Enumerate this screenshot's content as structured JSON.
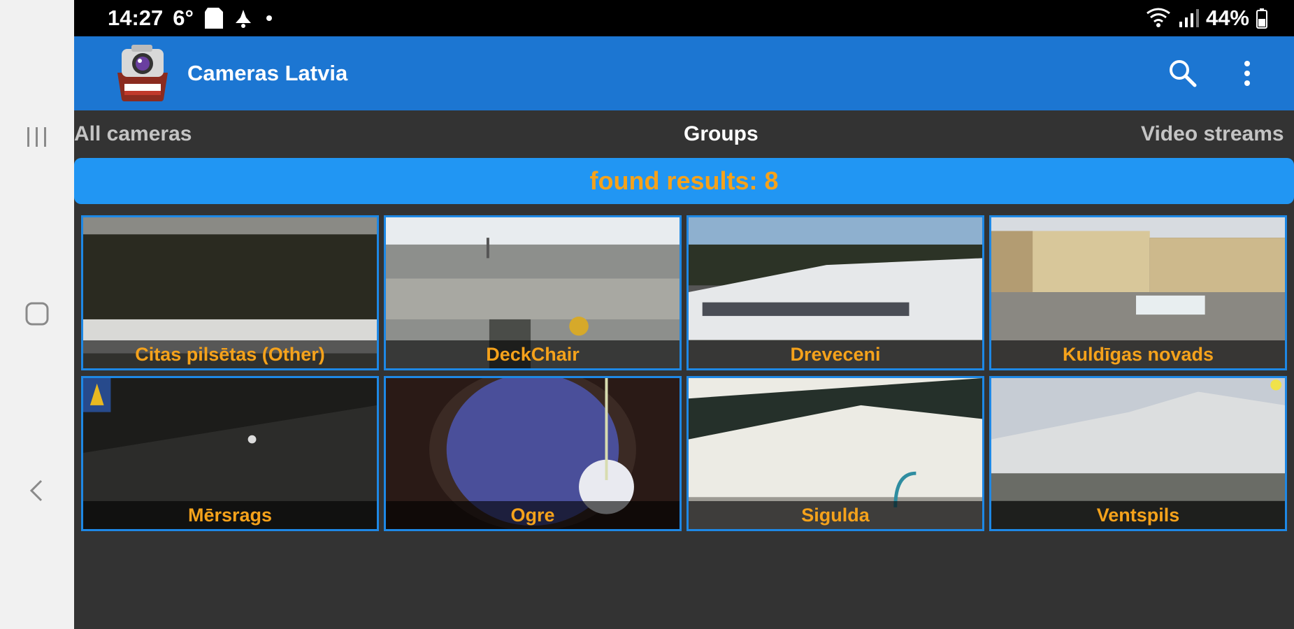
{
  "status_bar": {
    "time": "14:27",
    "temperature": "6°",
    "battery": "44%",
    "icons": [
      "sd-card-icon",
      "notification-icon",
      "dot-icon",
      "wifi-icon",
      "signal-icon",
      "battery-icon"
    ]
  },
  "app": {
    "title": "Cameras Latvia",
    "accent_color": "#1c76d2",
    "label_color": "#f5a21b"
  },
  "tabs": [
    {
      "label": "All cameras",
      "selected": false
    },
    {
      "label": "Groups",
      "selected": true
    },
    {
      "label": "Video streams",
      "selected": false
    }
  ],
  "results": {
    "text": "found results: 8"
  },
  "groups": [
    {
      "label": "Citas pilsētas (Other)"
    },
    {
      "label": "DeckChair"
    },
    {
      "label": "Dreveceni"
    },
    {
      "label": "Kuldīgas novads"
    },
    {
      "label": "Mērsrags"
    },
    {
      "label": "Ogre"
    },
    {
      "label": "Sigulda"
    },
    {
      "label": "Ventspils"
    }
  ],
  "nav": {
    "icons": [
      "recents-icon",
      "home-icon",
      "back-icon"
    ]
  }
}
